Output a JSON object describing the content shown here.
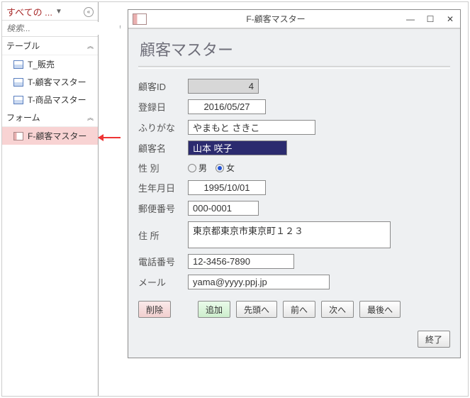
{
  "nav": {
    "header": "すべての ...",
    "search_placeholder": "検索...",
    "group_tables": "テーブル",
    "group_forms": "フォーム",
    "tables": [
      "T_販売",
      "T-顧客マスター",
      "T-商品マスター"
    ],
    "forms": [
      "F-顧客マスター"
    ]
  },
  "win": {
    "title": "F-顧客マスター",
    "form_title": "顧客マスター",
    "labels": {
      "id": "顧客ID",
      "reg": "登録日",
      "furi": "ふりがな",
      "name": "顧客名",
      "gender": "性 別",
      "birth": "生年月日",
      "zip": "郵便番号",
      "addr": "住 所",
      "tel": "電話番号",
      "mail": "メール"
    },
    "values": {
      "id": "4",
      "reg": "2016/05/27",
      "furi": "やまもと さきこ",
      "name": "山本 咲子",
      "birth": "1995/10/01",
      "zip": "000-0001",
      "addr": "東京都東京市東京町１２３",
      "tel": "12-3456-7890",
      "mail": "yama@yyyy.ppj.jp"
    },
    "gender": {
      "male": "男",
      "female": "女"
    },
    "buttons": {
      "delete": "削除",
      "add": "追加",
      "first": "先頭へ",
      "prev": "前へ",
      "next": "次へ",
      "last": "最後へ",
      "end": "終了"
    }
  }
}
